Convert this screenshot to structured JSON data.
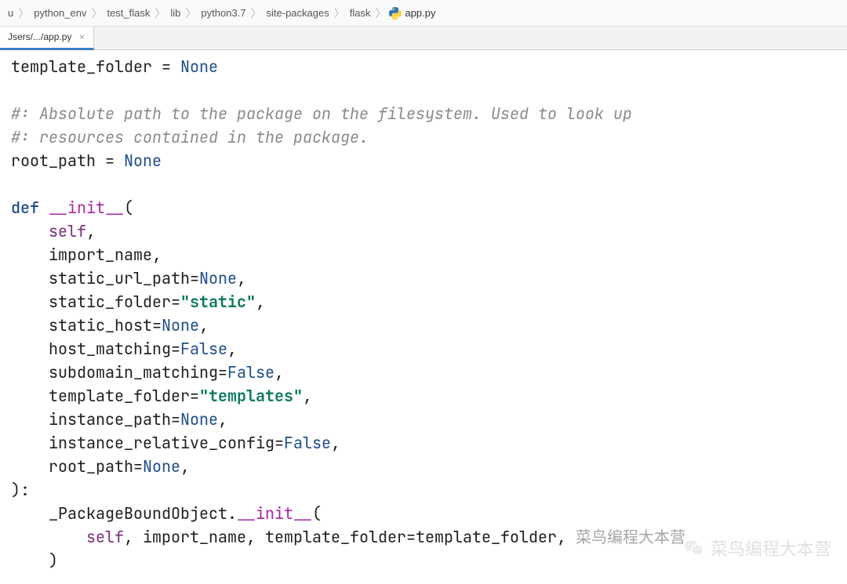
{
  "breadcrumb": {
    "items": [
      "python_env",
      "test_flask",
      "lib",
      "python3.7",
      "site-packages",
      "flask"
    ],
    "file": "app.py",
    "leading": "u"
  },
  "tab": {
    "label": "Jsers/.../app.py",
    "close_glyph": "×"
  },
  "code": {
    "line1_a": "template_folder = ",
    "line1_none": "None",
    "comment1": "#: Absolute path to the package on the filesystem. Used to look up",
    "comment2": "#: resources contained in the package.",
    "rootpath_a": "root_path = ",
    "rootpath_none": "None",
    "def_kw": "def",
    "dunder_init": "__init__",
    "open_paren": "(",
    "self_kw": "self",
    "comma": ",",
    "import_name": "    import_name,",
    "static_url_a": "    static_url_path=",
    "static_folder_a": "    static_folder=",
    "static_folder_str": "\"static\"",
    "static_host_a": "    static_host=",
    "host_match_a": "    host_matching=",
    "subdomain_a": "    subdomain_matching=",
    "template_f_a": "    template_folder=",
    "template_f_str": "\"templates\"",
    "instance_p_a": "    instance_path=",
    "instance_r_a": "    instance_relative_config=",
    "rootp_a": "    root_path=",
    "none_kw": "None",
    "false_kw": "False",
    "close_sig": "):",
    "pkgbound_a": "    _PackageBoundObject.",
    "pkg_open": "(",
    "call_line_a": "        ",
    "call_self": "self",
    "call_sep1": ", import_name, template_folder=template_folder, ",
    "call_tail": "菜鸟编程大本营",
    "call_close": "    )"
  },
  "watermark": {
    "text": "菜鸟编程大本营"
  },
  "breadcrumb_sep": "〉"
}
